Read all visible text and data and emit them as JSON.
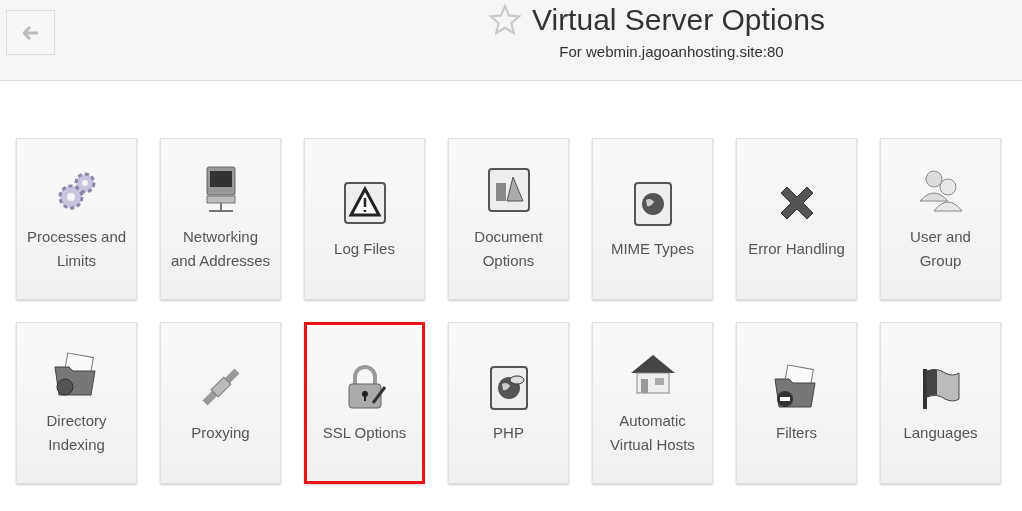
{
  "header": {
    "title": "Virtual Server Options",
    "subtitle": "For webmin.jagoanhosting.site:80"
  },
  "rows": [
    [
      {
        "label": "Processes and Limits",
        "kind": "gears",
        "selected": false
      },
      {
        "label": "Networking and Addresses",
        "kind": "computer",
        "selected": false
      },
      {
        "label": "Log Files",
        "kind": "warning",
        "selected": false
      },
      {
        "label": "Document Options",
        "kind": "shapes",
        "selected": false
      },
      {
        "label": "MIME Types",
        "kind": "globe",
        "selected": false
      },
      {
        "label": "Error Handling",
        "kind": "cross",
        "selected": false
      },
      {
        "label": "User and Group",
        "kind": "users",
        "selected": false
      }
    ],
    [
      {
        "label": "Directory Indexing",
        "kind": "folder",
        "selected": false
      },
      {
        "label": "Proxying",
        "kind": "connector",
        "selected": false
      },
      {
        "label": "SSL Options",
        "kind": "padlock",
        "selected": true
      },
      {
        "label": "PHP",
        "kind": "php",
        "selected": false
      },
      {
        "label": "Automatic Virtual Hosts",
        "kind": "house",
        "selected": false
      },
      {
        "label": "Filters",
        "kind": "folder-minus",
        "selected": false
      },
      {
        "label": "Languages",
        "kind": "flag",
        "selected": false
      }
    ]
  ]
}
